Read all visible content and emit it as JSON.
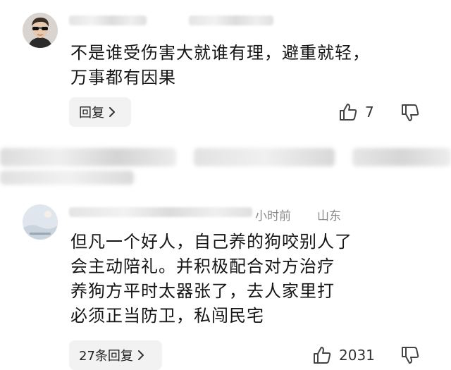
{
  "comments": [
    {
      "body_lines": [
        "不是谁受伤害大就谁有理，避重就轻，",
        "万事都有因果"
      ],
      "reply_label": "回复",
      "likes": "7"
    },
    {
      "meta_visible": "小时前",
      "location": "山东",
      "body_lines": [
        "但凡一个好人，自己养的狗咬别人了",
        "会主动陪礼。并积极配合对方治疗",
        "养狗方平时太器张了，去人家里打",
        "必须正当防卫，私闯民宅"
      ],
      "reply_label": "27条回复",
      "likes": "2031"
    }
  ],
  "icons": {
    "reply_chevron": "chevron-right-icon",
    "like": "thumbs-up-icon",
    "dislike": "thumbs-down-icon"
  },
  "colors": {
    "background": "#ffffff",
    "reply_button": "#f2f2f2",
    "meta_text": "#8a8a8a"
  }
}
